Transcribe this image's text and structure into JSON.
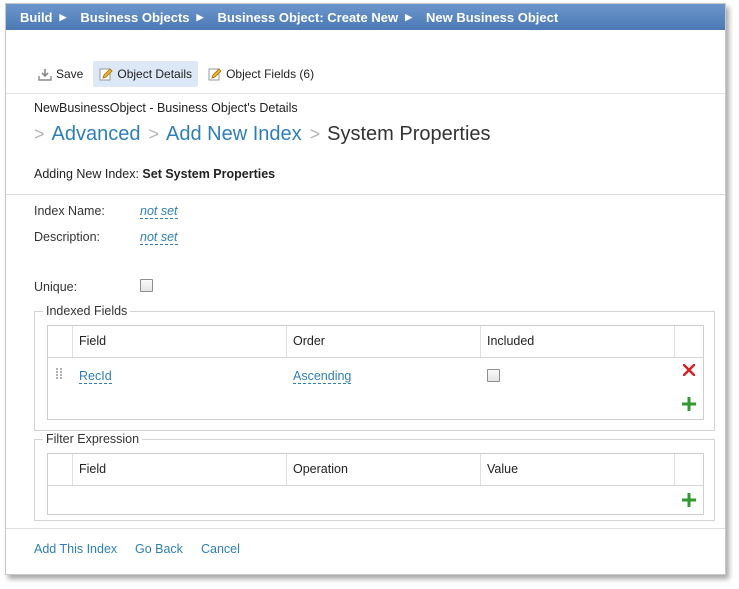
{
  "breadcrumb": {
    "items": [
      "Build",
      "Business Objects",
      "Business Object: Create New",
      "New Business Object"
    ]
  },
  "toolbar": {
    "save_label": "Save",
    "object_details_label": "Object Details",
    "object_fields_label": "Object Fields (6)"
  },
  "page": {
    "object_title": "NewBusinessObject - Business Object's Details",
    "heading_links": [
      "Advanced",
      "Add New Index"
    ],
    "heading_current": "System Properties",
    "subtitle_prefix": "Adding New Index:",
    "subtitle_value": "Set System Properties"
  },
  "form": {
    "index_name_label": "Index Name:",
    "index_name_value": "not set",
    "description_label": "Description:",
    "description_value": "not set",
    "unique_label": "Unique:",
    "unique_checked": false
  },
  "indexed_fields": {
    "legend": "Indexed Fields",
    "columns": [
      "Field",
      "Order",
      "Included"
    ],
    "rows": [
      {
        "field": "RecId",
        "order": "Ascending",
        "included": false
      }
    ]
  },
  "filter_expression": {
    "legend": "Filter Expression",
    "columns": [
      "Field",
      "Operation",
      "Value"
    ]
  },
  "footer": {
    "add_label": "Add This Index",
    "back_label": "Go Back",
    "cancel_label": "Cancel"
  },
  "colors": {
    "accent_link": "#2e7fb8",
    "header_bar": "#5a86c0",
    "delete_red": "#d42020",
    "add_green": "#2f9a2f"
  }
}
